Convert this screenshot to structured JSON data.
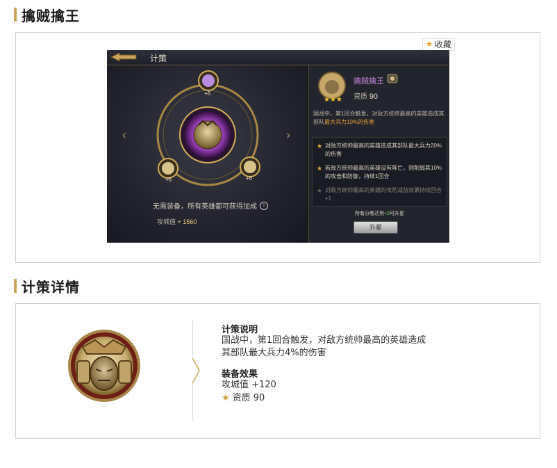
{
  "section1": {
    "title": "擒贼擒王",
    "favorite_label": "收藏"
  },
  "game": {
    "header_title": "计策",
    "rune_badges": [
      "+6",
      "+6",
      "+6"
    ],
    "equip_note": "无需装备，所有英雄都可获得加成",
    "attack": {
      "label": "攻城值",
      "value": "+ 1560"
    },
    "strategy": {
      "name": "擒贼擒王",
      "quality_label": "资质",
      "quality_value": "90",
      "desc_prefix": "国战中，第1回合触发，对敌方统帅最高的英雄造成其部队",
      "desc_highlight": "最大兵力10%的伤害",
      "levels": [
        {
          "text": "对敌方统帅最高的英雄造成其部队最大兵力20%的伤害",
          "unlocked": true
        },
        {
          "text": "若敌方统帅最高的英雄没有阵亡，则削弱其10%的攻击和防御，持续1回合",
          "unlocked": true
        },
        {
          "text": "对敌方统帅最高的英雄的攻防减益效果持续回合+1",
          "unlocked": false
        }
      ],
      "upgrade_req_prefix": "所有分卷达到",
      "upgrade_req_highlight": "+9",
      "upgrade_req_suffix": "可升星",
      "upgrade_button": "升星"
    }
  },
  "section2": {
    "title": "计策详情",
    "desc_heading": "计策说明",
    "desc_text": "国战中，第1回合触发，对敌方统帅最高的英雄造成其部队最大兵力4%的伤害",
    "effect_heading": "装备效果",
    "effect_attack": "攻城值 +120",
    "effect_quality": "资质 90"
  },
  "colors": {
    "accent_gold": "#c8a45a",
    "highlight_orange": "#e79c3a",
    "name_purple": "#c98ae0"
  }
}
